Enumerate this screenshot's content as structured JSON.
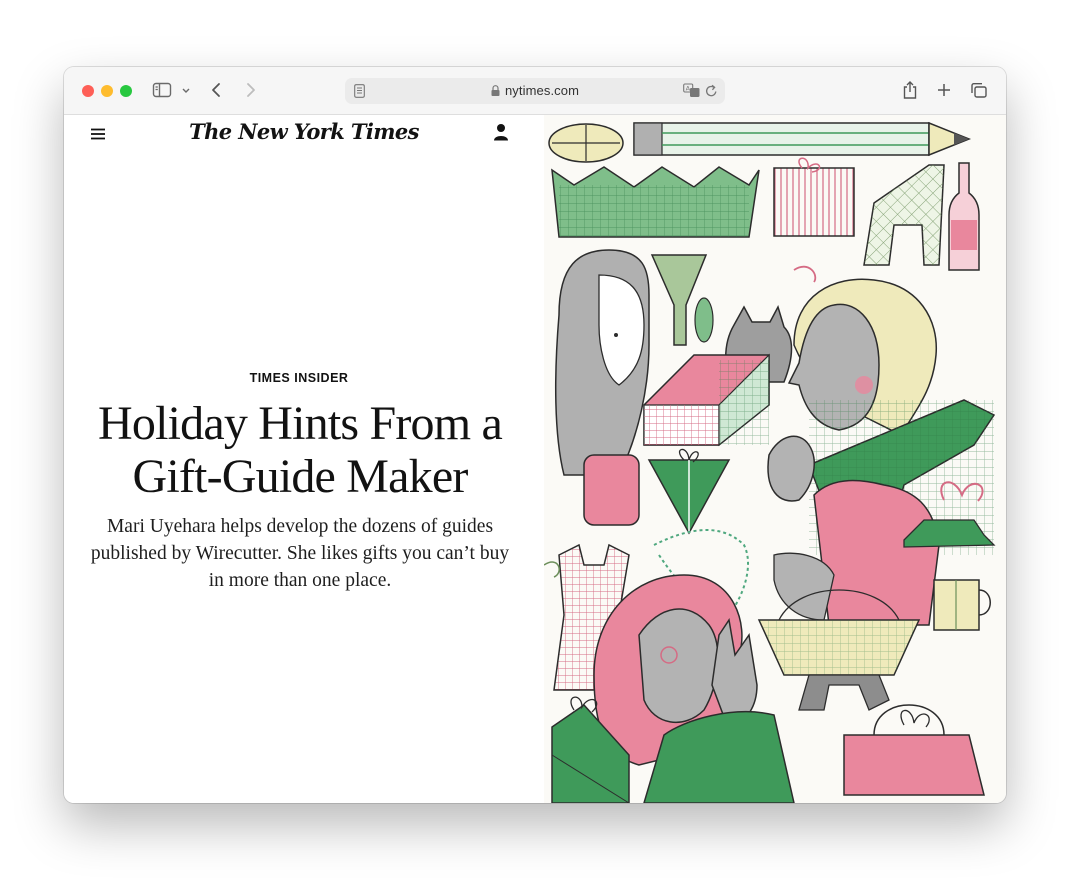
{
  "browser": {
    "url_display": "nytimes.com",
    "traffic_lights": {
      "close": "#fe5f57",
      "minimize": "#febc2e",
      "zoom": "#28c840"
    }
  },
  "page": {
    "masthead": "The New York Times",
    "kicker": "TIMES INSIDER",
    "headline": "Holiday Hints From a Gift-Guide Maker",
    "summary": "Mari Uyehara helps develop the dozens of guides published by Wirecutter. She likes gifts you can’t buy in more than one place."
  },
  "illustration": {
    "palette": {
      "green": "#3f9a5a",
      "pink": "#e9879d",
      "yellow": "#efeabb",
      "gray": "#a6a6a6",
      "outline": "#2c2c2c"
    }
  }
}
